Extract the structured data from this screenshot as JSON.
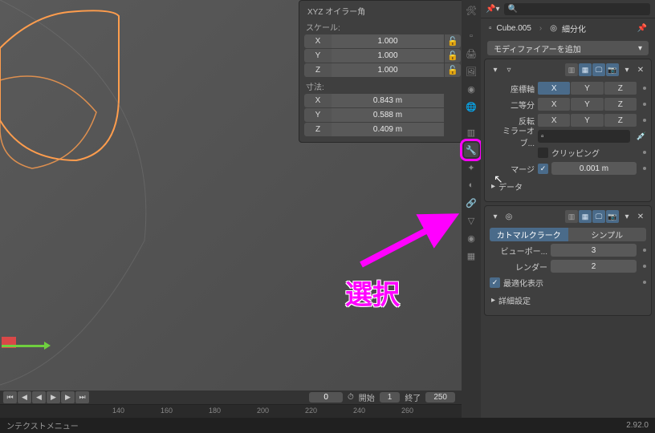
{
  "npanel": {
    "mode_label": "XYZ オイラー角",
    "scale_header": "スケール:",
    "dim_header": "寸法:",
    "scale": {
      "x": "X",
      "xv": "1.000",
      "y": "Y",
      "yv": "1.000",
      "z": "Z",
      "zv": "1.000"
    },
    "dim": {
      "x": "X",
      "xv": "0.843 m",
      "y": "Y",
      "yv": "0.588 m",
      "z": "Z",
      "zv": "0.409 m"
    }
  },
  "timeline": {
    "current": "0",
    "start_label": "開始",
    "start": "1",
    "end_label": "終了",
    "end": "250",
    "ticks": [
      {
        "pos": 140,
        "v": "140"
      },
      {
        "pos": 200,
        "v": "160"
      },
      {
        "pos": 260,
        "v": "180"
      },
      {
        "pos": 320,
        "v": "200"
      },
      {
        "pos": 380,
        "v": "220"
      },
      {
        "pos": 440,
        "v": "240"
      },
      {
        "pos": 500,
        "v": "260"
      }
    ]
  },
  "statusbar": {
    "ctx": "ンテクストメニュー",
    "version": "2.92.0"
  },
  "props": {
    "search_ph": "",
    "object": "Cube.005",
    "subdiv_badge": "細分化",
    "add_modifier": "モディファイアーを追加",
    "mirror": {
      "axis_label": "座標軸",
      "axis": [
        "X",
        "Y",
        "Z"
      ],
      "bisect_label": "二等分",
      "bisect": [
        "X",
        "Y",
        "Z"
      ],
      "flip_label": "反転",
      "flip": [
        "X",
        "Y",
        "Z"
      ],
      "mirror_obj_label": "ミラーオブ...",
      "clipping": "クリッピング",
      "merge": "マージ",
      "merge_val": "0.001 m",
      "data_header": "データ"
    },
    "subsurf": {
      "type_a": "カトマルクラーク",
      "type_b": "シンプル",
      "viewport_label": "ビューポー...",
      "viewport": "3",
      "render_label": "レンダー",
      "render": "2",
      "optimal": "最適化表示",
      "advanced": "詳細設定"
    }
  },
  "annotation": {
    "text": "選択"
  }
}
